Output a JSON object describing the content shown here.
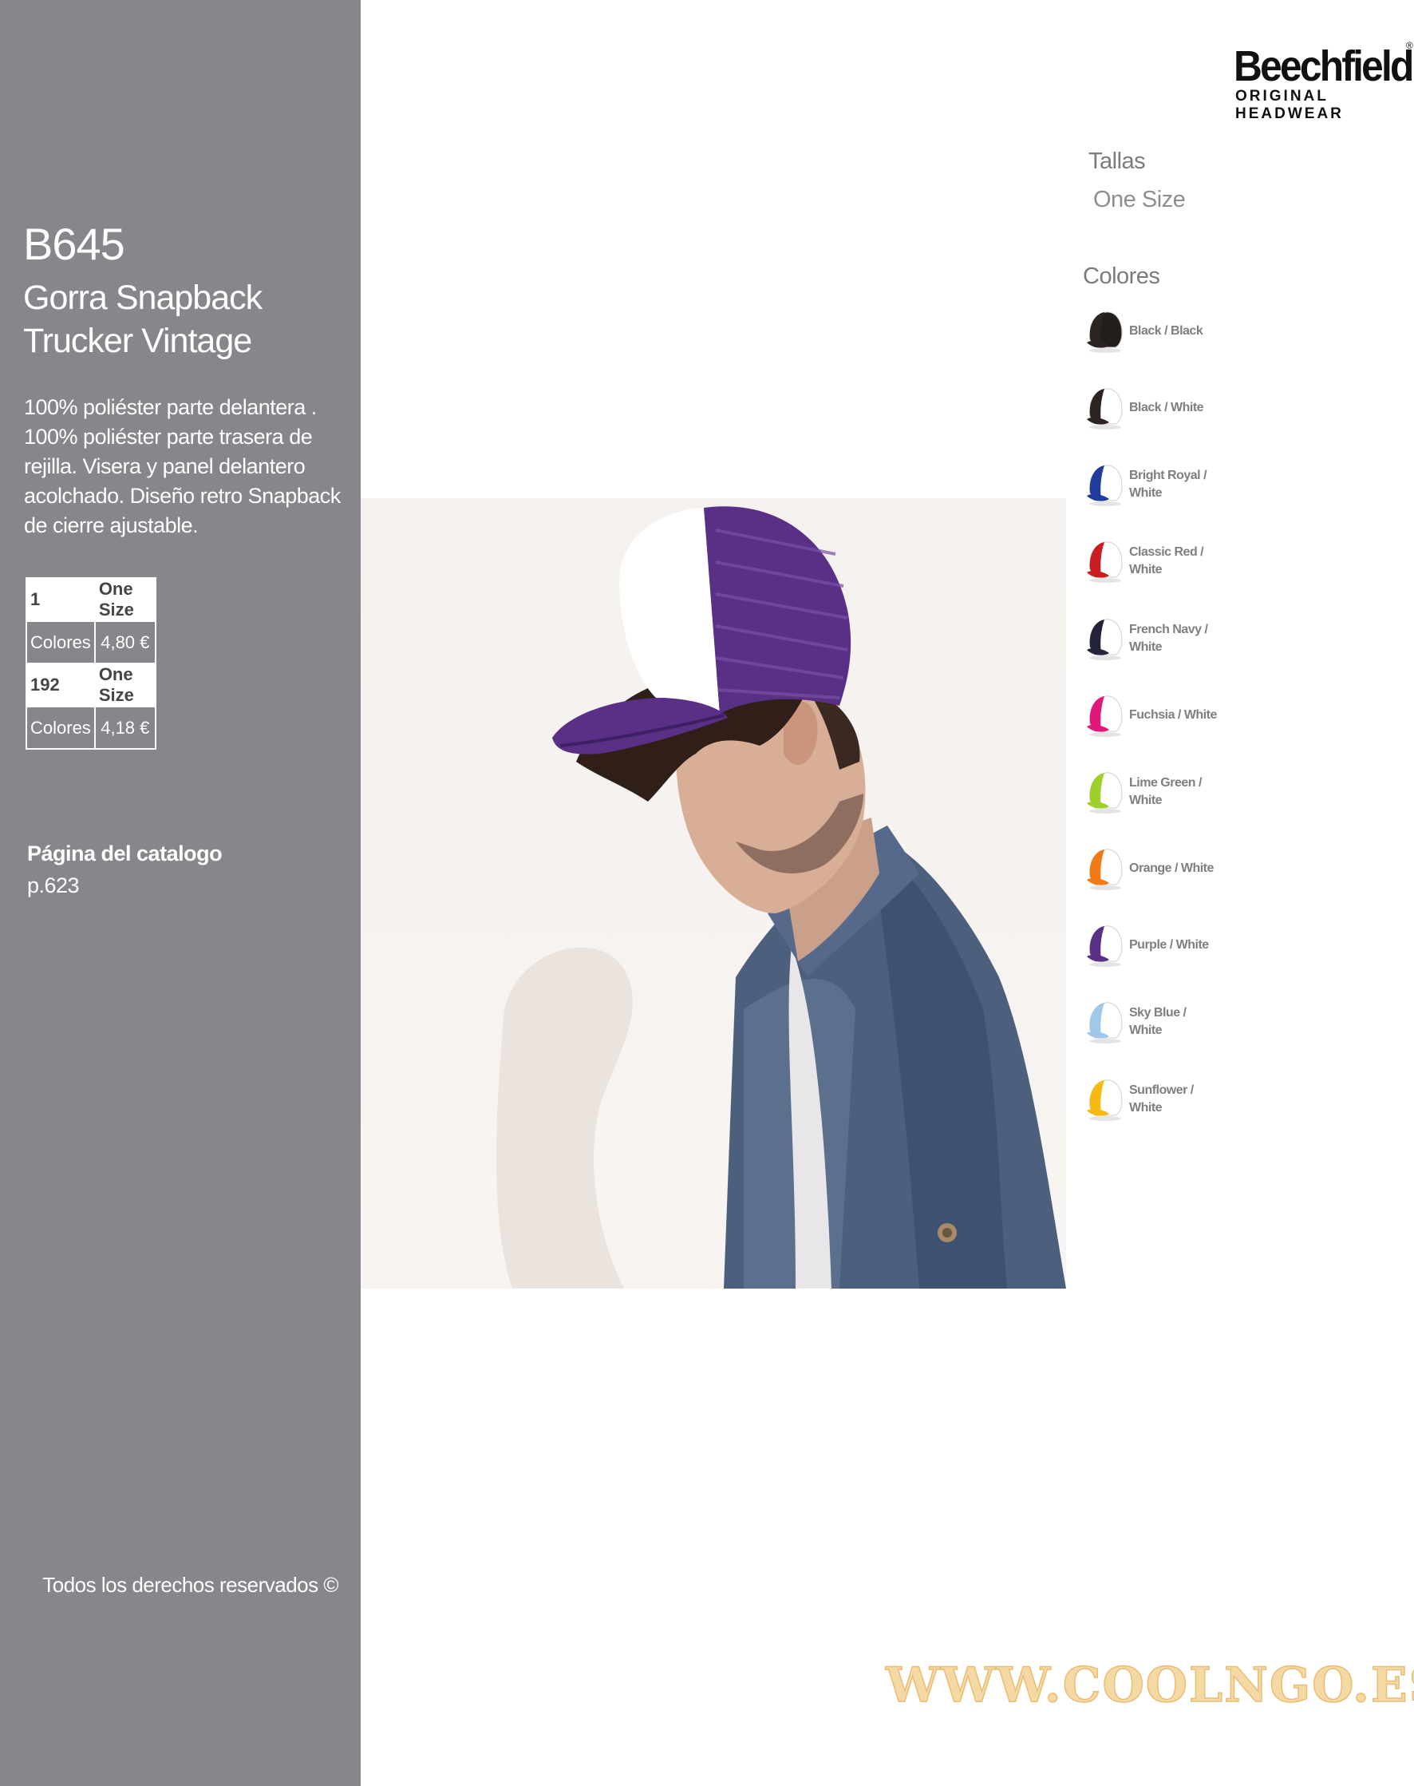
{
  "product": {
    "code": "B645",
    "name": "Gorra Snapback Trucker Vintage",
    "description": "100% poliéster parte delantera . 100% poliéster parte trasera de rejilla. Visera y panel delantero acolchado. Diseño retro Snapback de cierre ajustable."
  },
  "pricing": [
    {
      "qty": "1",
      "size": "One Size",
      "label": "Colores",
      "price": "4,80 €"
    },
    {
      "qty": "192",
      "size": "One Size",
      "label": "Colores",
      "price": "4,18 €"
    }
  ],
  "catalog": {
    "label": "Página del catalogo",
    "page": "p.623"
  },
  "rights": "Todos los derechos reservados ©",
  "brand": {
    "name": "Beechfield",
    "tagline": "ORIGINAL HEADWEAR",
    "reg": "®"
  },
  "sizes": {
    "heading": "Tallas",
    "value": "One Size"
  },
  "colors": {
    "heading": "Colores",
    "items": [
      {
        "line1": "Black / Black",
        "line2": "",
        "front": "#2b2421",
        "back": "#231d1b"
      },
      {
        "line1": "Black / White",
        "line2": "",
        "front": "#2b2421",
        "back": "#ffffff"
      },
      {
        "line1": "Bright Royal /",
        "line2": "White",
        "front": "#1f3b9c",
        "back": "#ffffff"
      },
      {
        "line1": "Classic Red /",
        "line2": "White",
        "front": "#c91d24",
        "back": "#ffffff"
      },
      {
        "line1": "French Navy /",
        "line2": "White",
        "front": "#23243a",
        "back": "#ffffff"
      },
      {
        "line1": "Fuchsia / White",
        "line2": "",
        "front": "#e0187a",
        "back": "#ffffff"
      },
      {
        "line1": "Lime Green /",
        "line2": "White",
        "front": "#9fcf2a",
        "back": "#ffffff"
      },
      {
        "line1": "Orange / White",
        "line2": "",
        "front": "#f27a14",
        "back": "#ffffff"
      },
      {
        "line1": "Purple / White",
        "line2": "",
        "front": "#5a2f86",
        "back": "#ffffff"
      },
      {
        "line1": "Sky Blue /",
        "line2": "White",
        "front": "#9fc8ea",
        "back": "#ffffff"
      },
      {
        "line1": "Sunflower /",
        "line2": "White",
        "front": "#f6b912",
        "back": "#ffffff"
      }
    ]
  },
  "watermark": "WWW.COOLNGO.ES"
}
